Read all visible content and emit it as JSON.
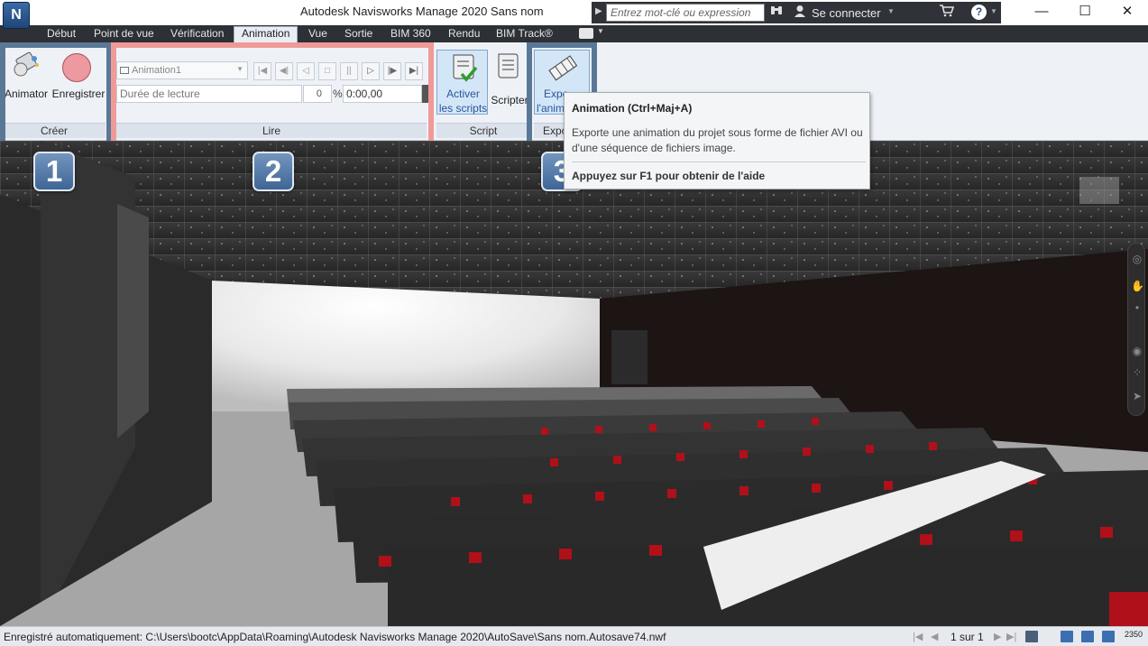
{
  "window": {
    "app_logo": "N",
    "title": "Autodesk Navisworks Manage 2020",
    "document": "Sans nom",
    "search_placeholder": "Entrez mot-clé ou expression",
    "sign_in": "Se connecter",
    "help": "?",
    "minimize": "—",
    "maximize": "☐",
    "close": "✕"
  },
  "tabs": [
    "Début",
    "Point de vue",
    "Vérification",
    "Animation",
    "Vue",
    "Sortie",
    "BIM 360",
    "Rendu",
    "BIM Track®"
  ],
  "active_tab": "Animation",
  "ribbon": {
    "creer": {
      "title": "Créer",
      "animator": "Animator",
      "enregistrer": "Enregistrer"
    },
    "lire": {
      "title": "Lire",
      "animation_select": "Animation1",
      "duration_label": "Durée de lecture",
      "percent": "0",
      "percent_sign": "%",
      "time": "0:00,00"
    },
    "script": {
      "title": "Script",
      "activer_line1": "Activer",
      "activer_line2": "les scripts",
      "scripter": "Scripter"
    },
    "export": {
      "title": "Expo",
      "label_line1": "Expo",
      "label_line2": "l'anim"
    }
  },
  "badges": [
    "1",
    "2",
    "3"
  ],
  "tooltip": {
    "title": "Animation (Ctrl+Maj+A)",
    "description": "Exporte une animation du projet sous forme de fichier AVI ou d'une séquence de fichiers image.",
    "help": "Appuyez sur F1 pour obtenir de l'aide"
  },
  "status": {
    "autosave": "Enregistré automatiquement: C:\\Users\\bootc\\AppData\\Roaming\\Autodesk Navisworks Manage 2020\\AutoSave\\Sans nom.Autosave74.nwf",
    "sheet_count": "1 sur 1",
    "memory": "2350"
  },
  "colors": {
    "highlight_blue": "#5a7896",
    "highlight_red": "#f09a97",
    "seat_red": "#b0101a",
    "tab_bar": "#2d3035"
  }
}
